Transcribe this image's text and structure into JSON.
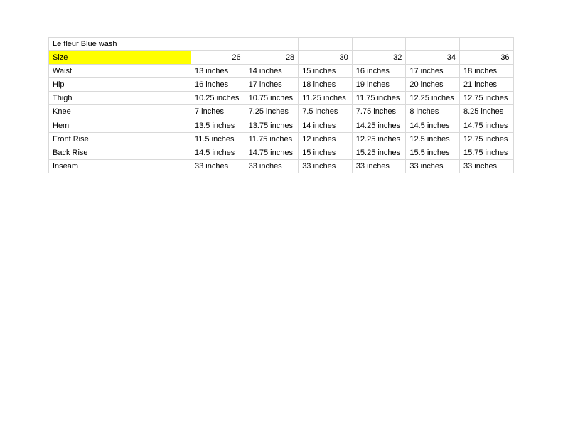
{
  "document": {
    "title": "Le fleur Blue wash",
    "highlight_color": "#ffff00",
    "border_color": "#d9d9d9",
    "background_color": "#ffffff",
    "text_color": "#000000"
  },
  "table": {
    "title_row": {
      "label": "Le fleur Blue wash",
      "blank_cells": [
        "",
        "",
        "",
        "",
        "",
        ""
      ]
    },
    "size_row": {
      "label": "Size",
      "sizes": [
        "26",
        "28",
        "30",
        "32",
        "34",
        "36"
      ]
    },
    "rows": [
      {
        "label": "Waist",
        "values": [
          "13 inches",
          "14 inches",
          "15 inches",
          "16 inches",
          "17 inches",
          "18 inches"
        ]
      },
      {
        "label": "Hip",
        "values": [
          "16 inches",
          "17 inches",
          "18 inches",
          "19 inches",
          "20 inches",
          "21 inches"
        ]
      },
      {
        "label": "Thigh",
        "values": [
          "10.25 inches",
          "10.75 inches",
          "11.25 inches",
          "11.75 inches",
          "12.25 inches",
          "12.75 inches"
        ]
      },
      {
        "label": "Knee",
        "values": [
          "7 inches",
          "7.25 inches",
          "7.5 inches",
          "7.75 inches",
          "8 inches",
          "8.25 inches"
        ]
      },
      {
        "label": "Hem",
        "values": [
          "13.5 inches",
          "13.75 inches",
          "14 inches",
          "14.25 inches",
          "14.5 inches",
          "14.75 inches"
        ]
      },
      {
        "label": "Front Rise",
        "values": [
          "11.5 inches",
          "11.75 inches",
          "12 inches",
          "12.25 inches",
          "12.5 inches",
          "12.75 inches"
        ]
      },
      {
        "label": "Back Rise",
        "values": [
          "14.5 inches",
          "14.75 inches",
          "15 inches",
          "15.25 inches",
          "15.5 inches",
          "15.75 inches"
        ]
      },
      {
        "label": "Inseam",
        "values": [
          "33 inches",
          "33 inches",
          "33 inches",
          "33 inches",
          "33 inches",
          "33 inches"
        ]
      }
    ]
  }
}
